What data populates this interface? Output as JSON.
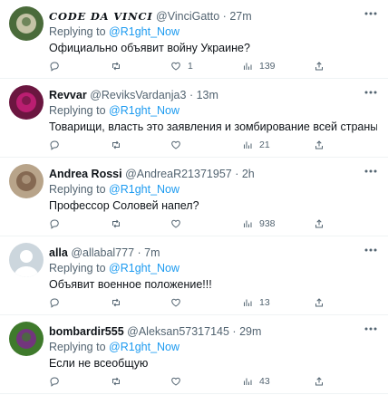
{
  "tweets": [
    {
      "display_name": "CODE DA VINCI",
      "name_style": "stylized",
      "handle": "@VinciGatto",
      "separator": "·",
      "time": "27m",
      "replying_prefix": "Replying to",
      "replying_to": "@R1ght_Now",
      "text": "Официально объявит войну Украине?",
      "avatar_colors": [
        "#4a6b3a",
        "#d9d2b8"
      ],
      "counts": {
        "replies": "",
        "retweets": "",
        "likes": "1",
        "views": "139"
      }
    },
    {
      "display_name": "Revvar",
      "name_style": "normal",
      "handle": "@ReviksVardanja3",
      "separator": "·",
      "time": "13m",
      "replying_prefix": "Replying to",
      "replying_to": "@R1ght_Now",
      "text": "Товарищи, власть это заявления и зомбирование всей страны.",
      "avatar_colors": [
        "#6b1640",
        "#c8207a"
      ],
      "counts": {
        "replies": "",
        "retweets": "",
        "likes": "",
        "views": "21"
      }
    },
    {
      "display_name": "Andrea Rossi",
      "name_style": "normal",
      "handle": "@AndreaR21371957",
      "separator": "·",
      "time": "2h",
      "replying_prefix": "Replying to",
      "replying_to": "@R1ght_Now",
      "text": "Профессор Соловей напел?",
      "avatar_colors": [
        "#b8a48a",
        "#7b5f48"
      ],
      "counts": {
        "replies": "",
        "retweets": "",
        "likes": "",
        "views": "938"
      }
    },
    {
      "display_name": "alla",
      "name_style": "normal",
      "handle": "@allabal777",
      "separator": "·",
      "time": "7m",
      "replying_prefix": "Replying to",
      "replying_to": "@R1ght_Now",
      "text": "Объявит военное положение!!!",
      "avatar_colors": [
        "#ccd6dd",
        "#ffffff"
      ],
      "counts": {
        "replies": "",
        "retweets": "",
        "likes": "",
        "views": "13"
      }
    },
    {
      "display_name": "bombardir555",
      "name_style": "normal",
      "handle": "@Aleksan57317145",
      "separator": "·",
      "time": "29m",
      "replying_prefix": "Replying to",
      "replying_to": "@R1ght_Now",
      "text": "Если не всеобщую",
      "avatar_colors": [
        "#3f7a2c",
        "#7b2a8c"
      ],
      "counts": {
        "replies": "",
        "retweets": "",
        "likes": "",
        "views": "43"
      }
    }
  ],
  "colors": {
    "accent": "#1d9bf0",
    "muted": "#536471",
    "text": "#0f1419",
    "divider": "#eff3f4"
  }
}
